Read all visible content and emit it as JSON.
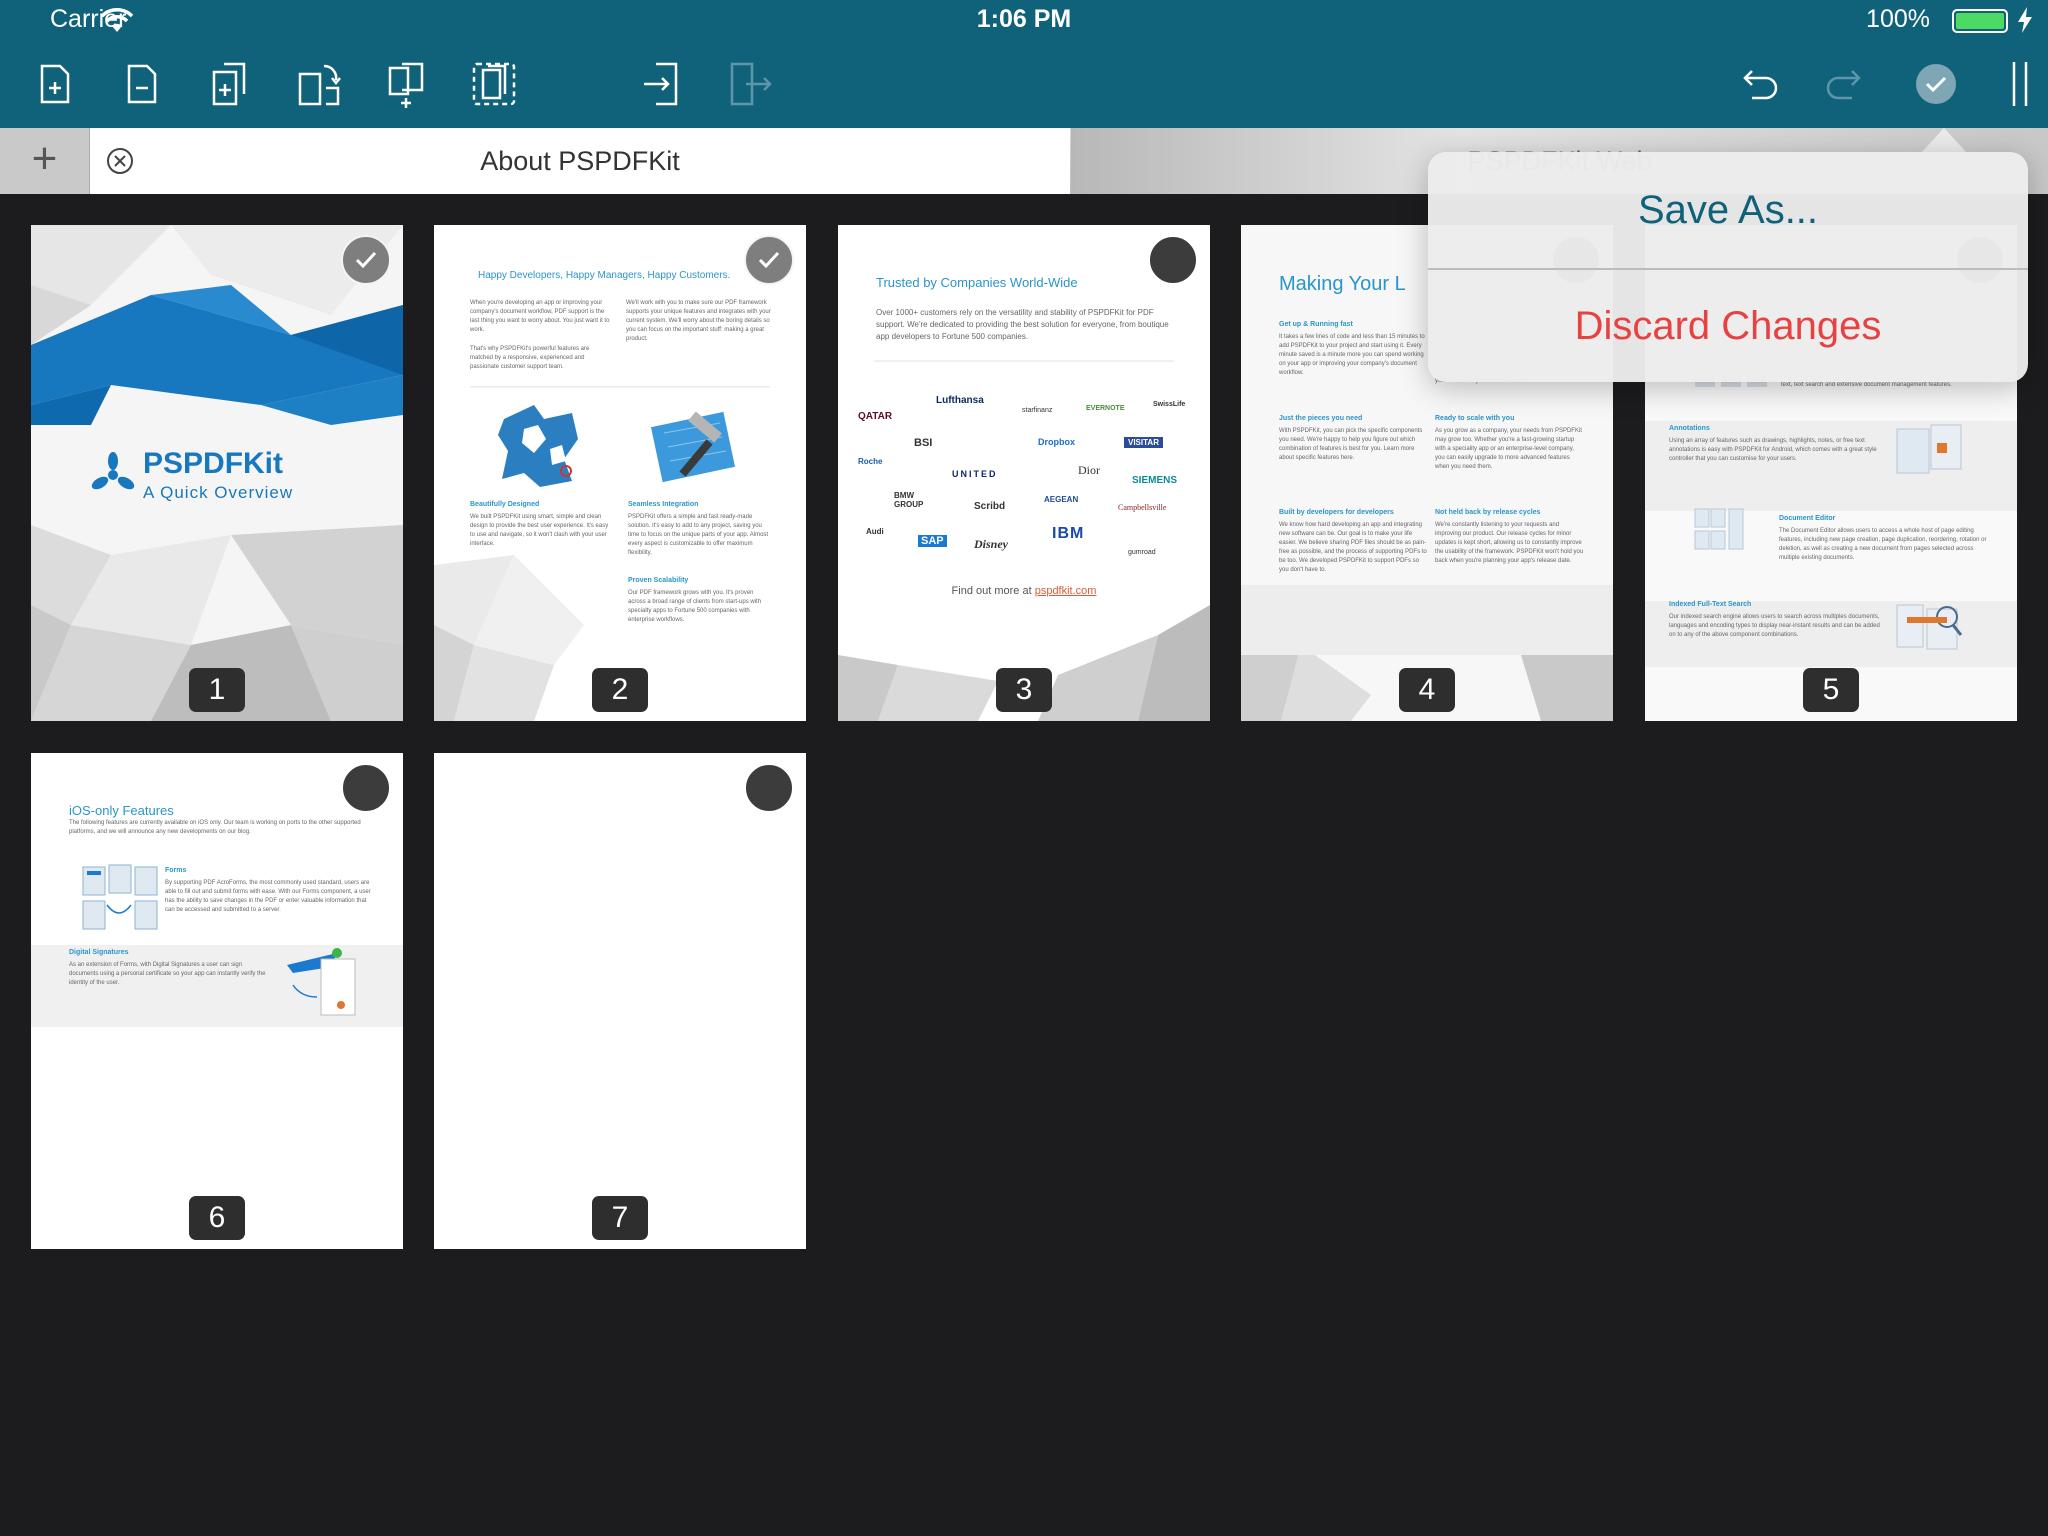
{
  "status_bar": {
    "carrier": "Carrier",
    "time": "1:06 PM",
    "battery": "100%"
  },
  "toolbar": {
    "icons": [
      "add-page-icon",
      "remove-page-icon",
      "duplicate-page-icon",
      "rotate-page-icon",
      "copy-pages-icon",
      "select-all-icon",
      "export-icon",
      "import-icon",
      "undo-icon",
      "redo-icon",
      "done-icon",
      "sidebar-icon"
    ]
  },
  "tabs": {
    "add_label": "+",
    "active_title": "About PSPDFKit",
    "second_title": "PSPDFKit Web"
  },
  "popover": {
    "save_as": "Save As...",
    "discard": "Discard Changes"
  },
  "pages": [
    {
      "number": "1",
      "selected": true
    },
    {
      "number": "2",
      "selected": true
    },
    {
      "number": "3",
      "selected": false
    },
    {
      "number": "4",
      "selected": false
    },
    {
      "number": "5",
      "selected": false
    },
    {
      "number": "6",
      "selected": false
    },
    {
      "number": "7",
      "selected": false
    }
  ],
  "page1": {
    "brand": "PSPDFKit",
    "subtitle": "A Quick Overview"
  },
  "page2": {
    "heading": "Happy Developers, Happy Managers, Happy Customers.",
    "col1": "When you're developing an app or improving your company's document workflow, PDF support is the last thing you want to worry about. You just want it to work.",
    "col1b": "That's why PSPDFKit's powerful features are matched by a responsive, experienced and passionate customer support team.",
    "col2": "We'll work with you to make sure our PDF framework supports your unique features and integrates with your current system. We'll worry about the boring details so you can focus on the important stuff: making a great product.",
    "h_designed": "Beautifully Designed",
    "t_designed": "We built PSPDFKit using smart, simple and clean design to provide the best user experience. It's easy to use and navigate, so it won't clash with your user interface.",
    "h_integration": "Seamless Integration",
    "t_integration": "PSPDFKit offers a simple and fast ready-made solution. It's easy to add to any project, saving you time to focus on the unique parts of your app. Almost every aspect is customizable to offer maximum flexibility.",
    "h_scal": "Proven Scalability",
    "t_scal": "Our PDF framework grows with you. It's proven across a broad range of clients from start-ups with specialty apps to Fortune 500 companies with enterprise workflows."
  },
  "page3": {
    "heading": "Trusted by Companies World-Wide",
    "intro": "Over 1000+ customers rely on the versatility and stability of PSPDFKit for PDF support. We're dedicated to providing the best solution for everyone, from boutique app developers to Fortune 500 companies.",
    "logos": [
      "QATAR",
      "Lufthansa",
      "starfinanz",
      "EVERNOTE",
      "SwissLife",
      "BSI",
      "Dropbox",
      "VISITAR",
      "Roche",
      "UNITED",
      "Dior",
      "SIEMENS",
      "BMW GROUP",
      "Scribd",
      "AEGEAN",
      "Campbellsville",
      "Audi",
      "SAP",
      "Disney",
      "IBM",
      "gumroad"
    ],
    "footer_text": "Find out more at ",
    "footer_link": "pspdfkit.com"
  },
  "page4": {
    "heading": "Making Your L",
    "h1": "Get up & Running fast",
    "t1": "It takes a few lines of code and less than 15 minutes to add PSPDFKit to your project and start using it. Every minute saved is a minute more you can spend working on your app or improving your company's document workflow.",
    "t1b": "your own variety of UI or features.",
    "h2": "Just the pieces you need",
    "t2": "With PSPDFKit, you can pick the specific components you need. We're happy to help you figure out which combination of features is best for you. Learn more about specific features here.",
    "h3": "Ready to scale with you",
    "t3": "As you grow as a company, your needs from PSPDFKit may grow too. Whether you're a fast-growing startup with a speciality app or an enterprise-level company, you can easily upgrade to more advanced features when you need them.",
    "h4": "Built by developers for developers",
    "t4": "We know how hard developing an app and integrating new software can be. Our goal is to make your life easier. We believe sharing PDF files should be as pain-free as possible, and the process of supporting PDFs to be too. We developed PSPDFKit to support PDFs so you don't have to.",
    "h5": "Not held back by release cycles",
    "t5": "We're constantly listening to your requests and improving our product. Our release cycles for minor updates is kept short, allowing us to constantly improve the usability of the framework. PSPDFKit won't hold you back when you're planning your app's release date."
  },
  "page5": {
    "t0": "text, text search and extensive document management features.",
    "h1": "Annotations",
    "t1": "Using an array of features such as drawings, highlights, notes, or free text annotations is easy with PSPDFKit for Android, which comes with a great style controller that you can customise for your users.",
    "h2": "Document Editor",
    "t2": "The Document Editor allows users to access a whole host of page editing features, including new page creation, page duplication, reordering, rotation or deletion, as well as creating a new document from pages selected across multiple existing documents.",
    "h3": "Indexed Full-Text Search",
    "t3": "Our indexed search engine allows users to search across multiples documents, languages and encoding types to display near-instant results and can be added on to any of the above component combinations."
  },
  "page6": {
    "heading": "iOS-only Features",
    "intro": "The following features are currently available on iOS only. Our team is working on ports to the other supported platforms, and we will announce any new developments on our blog.",
    "h1": "Forms",
    "t1": "By supporting PDF AcroForms, the most commonly used standard, users are able to fill out and submit forms with ease. With our Forms component, a user has the ability to save changes in the PDF or enter valuable information that can be accessed and submitted to a server.",
    "h2": "Digital Signatures",
    "t2": "As an extension of Forms, with Digital Signatures a user can sign documents using a personal certificate so your app can instantly verify the identity of the user."
  },
  "colors": {
    "bar": "#10617a",
    "discard": "#e74141",
    "accent": "#2a95c9"
  }
}
